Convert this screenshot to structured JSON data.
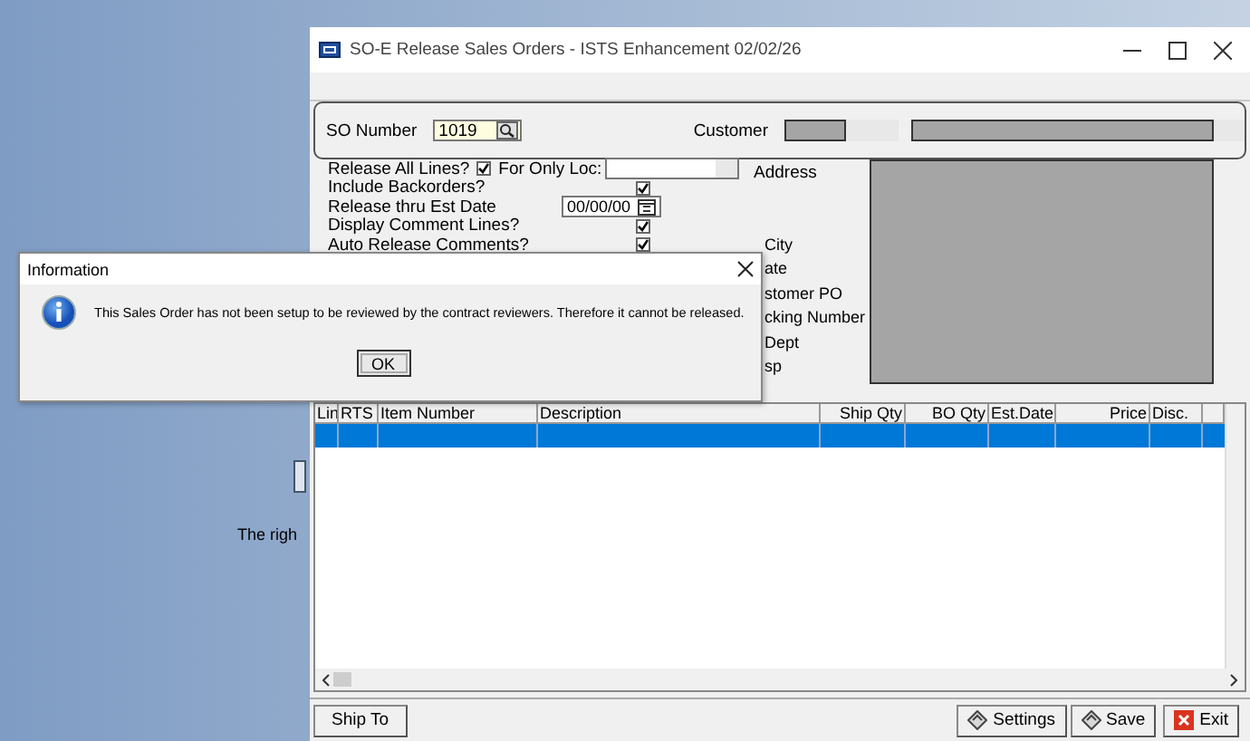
{
  "background_window": {
    "text": "The righ"
  },
  "window": {
    "title": "SO-E  Release Sales Orders - ISTS Enhancement 02/02/26"
  },
  "header": {
    "so_number_label": "SO Number",
    "so_number": "1019",
    "customer_label": "Customer"
  },
  "form_rows": [
    {
      "kind": "check_loc",
      "label": "Release All Lines?",
      "checked": true,
      "field_label": "For Only Loc:"
    },
    {
      "kind": "check",
      "label": "Include Backorders?",
      "checked": true
    },
    {
      "kind": "date",
      "label": "Release thru Est Date",
      "value": "00/00/00"
    },
    {
      "kind": "check",
      "label": "Display Comment Lines?",
      "checked": true
    },
    {
      "kind": "check",
      "label": "Auto Release Comments?",
      "checked": true
    }
  ],
  "address_label": "Address",
  "labels": [
    "City",
    "ate",
    "stomer PO",
    "cking Number",
    "Dept",
    "sp"
  ],
  "grid": {
    "columns": [
      "Lin",
      "RTS",
      "Item Number",
      "Description",
      "Ship Qty",
      "BO Qty",
      "Est.Date",
      "Price",
      "Disc."
    ],
    "rows": [
      {
        "selected": true
      }
    ]
  },
  "buttons": [
    {
      "kind": "left",
      "label": "Ship To"
    },
    {
      "kind": "settings",
      "label": "Settings"
    },
    {
      "kind": "save",
      "label": "Save"
    },
    {
      "kind": "exit",
      "label": "Exit"
    }
  ],
  "dialog": {
    "title": "Information",
    "message": "This Sales Order has not been setup to be reviewed by the contract reviewers.  Therefore it cannot be released.",
    "button": "OK"
  }
}
